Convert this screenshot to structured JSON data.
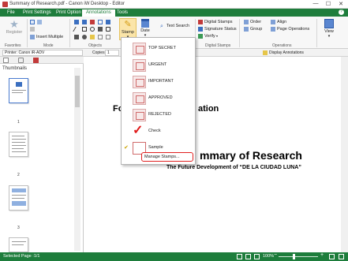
{
  "window": {
    "title": "Summary of Research.pdf - Canon iW Desktop - Editor",
    "minimize": "—",
    "maximize": "☐",
    "close": "✕"
  },
  "ribbon_tabs": [
    "File",
    "Print Settings",
    "Print Option",
    "Annotations",
    "Tools"
  ],
  "help": "?",
  "ribbon": {
    "register": "Register",
    "insert_multiple": "Insert Multiple",
    "stamp": "Stamp",
    "date": "Date",
    "text_search": "Text Search",
    "digital_stamps": "Digital Stamps",
    "signature_status": "Signature Status",
    "verify": "Verify",
    "order": "Order",
    "group": "Group",
    "align": "Align",
    "page_operations": "Page Operations",
    "view": "View",
    "groups": {
      "favorites": "Favorites",
      "mode": "Mode",
      "objects": "Objects",
      "digital_stamps": "Digital Stamps",
      "operations": "Operations",
      "annotation_partial": "otation"
    }
  },
  "printbar": {
    "printer": "Printer: Canon iR-ADV",
    "copies_label": "Copies:",
    "copies_value": "1",
    "display_annotations": "Display Annotations"
  },
  "left_panel": {
    "header": "Thumbnails",
    "pages": [
      "1",
      "2",
      "3"
    ]
  },
  "document": {
    "heading_partial_left": "Fo",
    "heading_partial_right": "ation",
    "title_partial": "mmary of Research",
    "subtitle": "The Future Development of “DE LA CIUDAD LUNA”"
  },
  "stamp_menu": {
    "items": [
      {
        "label": "TOP SECRET"
      },
      {
        "label": "URGENT"
      },
      {
        "label": "IMPORTANT"
      },
      {
        "label": "APPROVED"
      },
      {
        "label": "REJECTED"
      },
      {
        "label": "Check"
      },
      {
        "label": "Sample"
      }
    ],
    "manage": "Manage Stamps..."
  },
  "statusbar": {
    "selected_page": "Selected Page :1/1",
    "zoom": "100%"
  }
}
